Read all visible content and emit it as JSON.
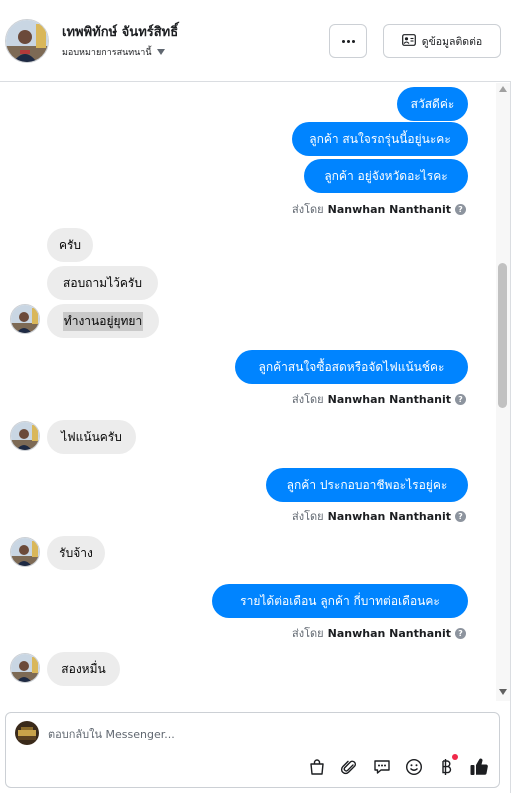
{
  "header": {
    "contact_name": "เทพพิทักษ์ จันทร์สิทธิ์",
    "assign_label": "มอบหมายการสนทนานี้",
    "more_label": "...",
    "contact_info_label": "ดูข้อมูลติดต่อ"
  },
  "messages": {
    "out_1": "สวัสดีค่ะ",
    "out_2": "ลูกค้า  สนใจรถรุ่นนี้อยู่นะคะ",
    "out_3": "ลูกค้า  อยู่จังหวัดอะไรคะ",
    "in_1": "ครับ",
    "in_2": "สอบถามไว้ครับ",
    "in_3": "ทำงานอยู่ยุทยา",
    "out_4": "ลูกค้าสนใจซื้อสดหรือจัดไฟแน้นช์คะ",
    "in_4": "ไฟแน้นครับ",
    "out_5": "ลูกค้า  ประกอบอาชีพอะไรอยู่คะ",
    "in_5": "รับจ้าง",
    "out_6": "รายได้ต่อเดือน  ลูกค้า  กี่บาทต่อเดือนคะ",
    "in_6": "สองหมื่น"
  },
  "sent_by": {
    "prefix": "ส่งโดย",
    "name": "Nanwhan Nanthanit"
  },
  "composer": {
    "placeholder": "ตอบกลับใน Messenger..."
  },
  "icons": [
    "more-icon",
    "contact-card-icon",
    "chevron-down-icon",
    "info-icon",
    "shopping-bag-icon",
    "paperclip-icon",
    "saved-replies-icon",
    "emoji-icon",
    "baht-icon",
    "like-icon"
  ],
  "colors": {
    "outgoing_bubble": "#0084ff",
    "incoming_bubble": "#ececec",
    "notification_dot": "#f02849",
    "like": "#1c1e21"
  }
}
